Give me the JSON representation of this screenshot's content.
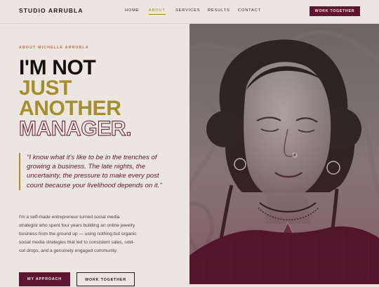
{
  "nav": {
    "brand": "STUDIO ARRUBLA",
    "links": [
      {
        "label": "HOME",
        "active": false
      },
      {
        "label": "ABOUT",
        "active": true
      },
      {
        "label": "SERVICES",
        "active": false
      },
      {
        "label": "RESULTS",
        "active": false
      },
      {
        "label": "CONTACT",
        "active": false
      }
    ],
    "cta_label": "WORK TOGETHER"
  },
  "hero": {
    "eyebrow": "ABOUT MICHELLE ARRUBLA",
    "headline": [
      "I'M NOT",
      "JUST",
      "ANOTHER",
      "MANAGER."
    ],
    "quote": "\"I know what it's like to be in the trenches of growing a business. The late nights, the uncertainty, the pressure to make every post count because your livelihood depends on it.\"",
    "bio": "I'm a self-made entrepreneur turned social media strategist who spent four years building an online jewelry business from the ground up — using nothing but organic social media strategies that led to consistent sales, sold-out drops, and a genuinely engaged community.",
    "primary_button": "MY APPROACH",
    "secondary_button": "WORK TOGETHER"
  },
  "colors": {
    "background": "#ece6e1",
    "accent_burgundy": "#5e1630",
    "accent_gold": "#a58f2c",
    "eyebrow": "#c26a4c"
  }
}
